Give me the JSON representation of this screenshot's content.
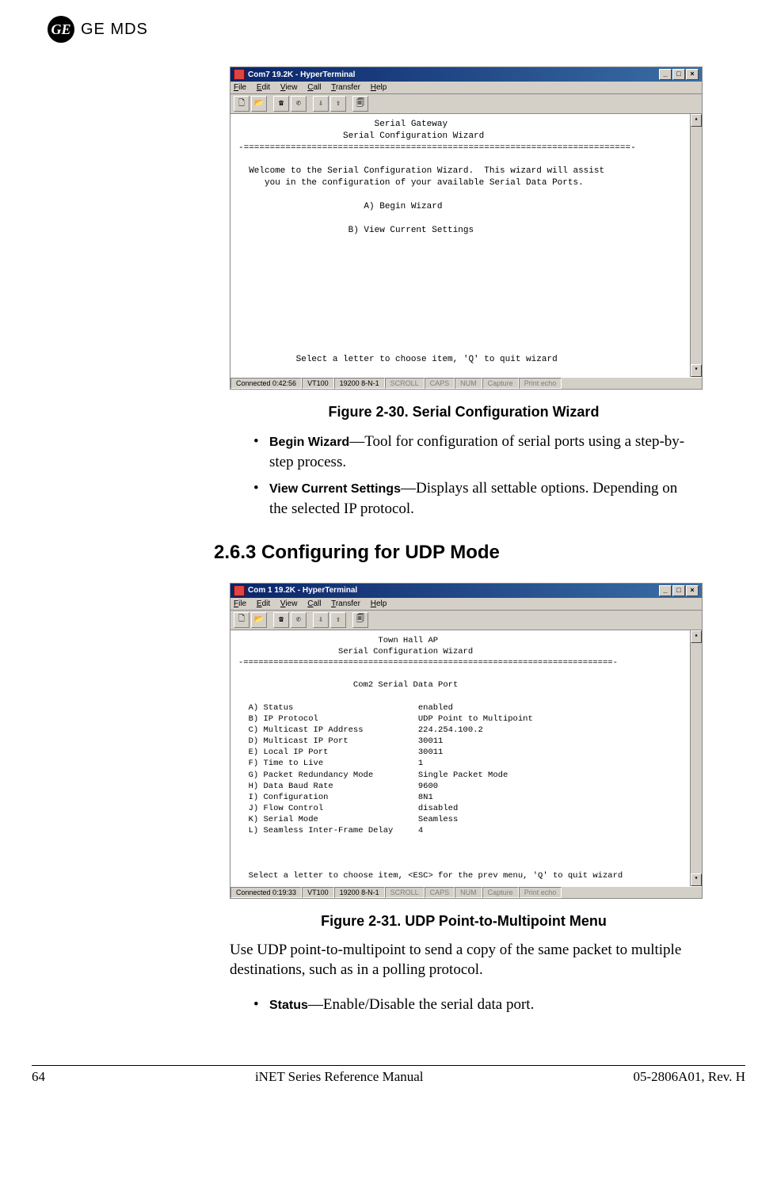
{
  "header": {
    "logo_script": "GE",
    "logo_text": "GE MDS"
  },
  "terminal1": {
    "title": "Com7 19.2K - HyperTerminal",
    "menu": [
      "File",
      "Edit",
      "View",
      "Call",
      "Transfer",
      "Help"
    ],
    "body": "                          Serial Gateway\n                    Serial Configuration Wizard\n-==========================================================================-\n\n  Welcome to the Serial Configuration Wizard.  This wizard will assist\n     you in the configuration of your available Serial Data Ports.\n\n                        A) Begin Wizard\n\n                     B) View Current Settings\n\n\n\n\n\n\n\n\n\n\n           Select a letter to choose item, 'Q' to quit wizard",
    "status": {
      "connected": "Connected 0:42:56",
      "emu": "VT100",
      "port": "19200 8-N-1",
      "scroll": "SCROLL",
      "caps": "CAPS",
      "num": "NUM",
      "capture": "Capture",
      "echo": "Print echo"
    }
  },
  "caption1": "Figure 2-30. Serial Configuration Wizard",
  "bullets1": [
    {
      "name": "Begin Wizard",
      "desc": "—Tool for configuration of serial ports using a step-by-step process."
    },
    {
      "name": "View Current Settings",
      "desc": "—Displays all settable options. Depend­ing on the selected IP protocol."
    }
  ],
  "section_heading": "2.6.3 Configuring for UDP Mode",
  "terminal2": {
    "title": "Com 1 19.2K - HyperTerminal",
    "menu": [
      "File",
      "Edit",
      "View",
      "Call",
      "Transfer",
      "Help"
    ],
    "body": "                            Town Hall AP\n                    Serial Configuration Wizard\n-==========================================================================-\n\n                       Com2 Serial Data Port\n\n  A) Status                         enabled\n  B) IP Protocol                    UDP Point to Multipoint\n  C) Multicast IP Address           224.254.100.2\n  D) Multicast IP Port              30011\n  E) Local IP Port                  30011\n  F) Time to Live                   1\n  G) Packet Redundancy Mode         Single Packet Mode\n  H) Data Baud Rate                 9600\n  I) Configuration                  8N1\n  J) Flow Control                   disabled\n  K) Serial Mode                    Seamless\n  L) Seamless Inter-Frame Delay     4\n\n\n\n  Select a letter to choose item, <ESC> for the prev menu, 'Q' to quit wizard",
    "status": {
      "connected": "Connected 0:19:33",
      "emu": "VT100",
      "port": "19200 8-N-1",
      "scroll": "SCROLL",
      "caps": "CAPS",
      "num": "NUM",
      "capture": "Capture",
      "echo": "Print echo"
    }
  },
  "caption2": "Figure 2-31. UDP Point-to-Multipoint Menu",
  "para1": "Use UDP point-to-multipoint to send a copy of the same packet to mul­tiple destinations, such as in a polling protocol.",
  "bullets2": [
    {
      "name": "Status",
      "desc": "—Enable/Disable the serial data port."
    }
  ],
  "footer": {
    "page": "64",
    "center": "iNET Series Reference Manual",
    "right": "05-2806A01, Rev. H"
  },
  "chart_data": {
    "type": "table",
    "title": "Com2 Serial Data Port (Serial Configuration Wizard)",
    "rows": [
      {
        "key": "A",
        "label": "Status",
        "value": "enabled"
      },
      {
        "key": "B",
        "label": "IP Protocol",
        "value": "UDP Point to Multipoint"
      },
      {
        "key": "C",
        "label": "Multicast IP Address",
        "value": "224.254.100.2"
      },
      {
        "key": "D",
        "label": "Multicast IP Port",
        "value": "30011"
      },
      {
        "key": "E",
        "label": "Local IP Port",
        "value": "30011"
      },
      {
        "key": "F",
        "label": "Time to Live",
        "value": "1"
      },
      {
        "key": "G",
        "label": "Packet Redundancy Mode",
        "value": "Single Packet Mode"
      },
      {
        "key": "H",
        "label": "Data Baud Rate",
        "value": "9600"
      },
      {
        "key": "I",
        "label": "Configuration",
        "value": "8N1"
      },
      {
        "key": "J",
        "label": "Flow Control",
        "value": "disabled"
      },
      {
        "key": "K",
        "label": "Serial Mode",
        "value": "Seamless"
      },
      {
        "key": "L",
        "label": "Seamless Inter-Frame Delay",
        "value": "4"
      }
    ]
  }
}
